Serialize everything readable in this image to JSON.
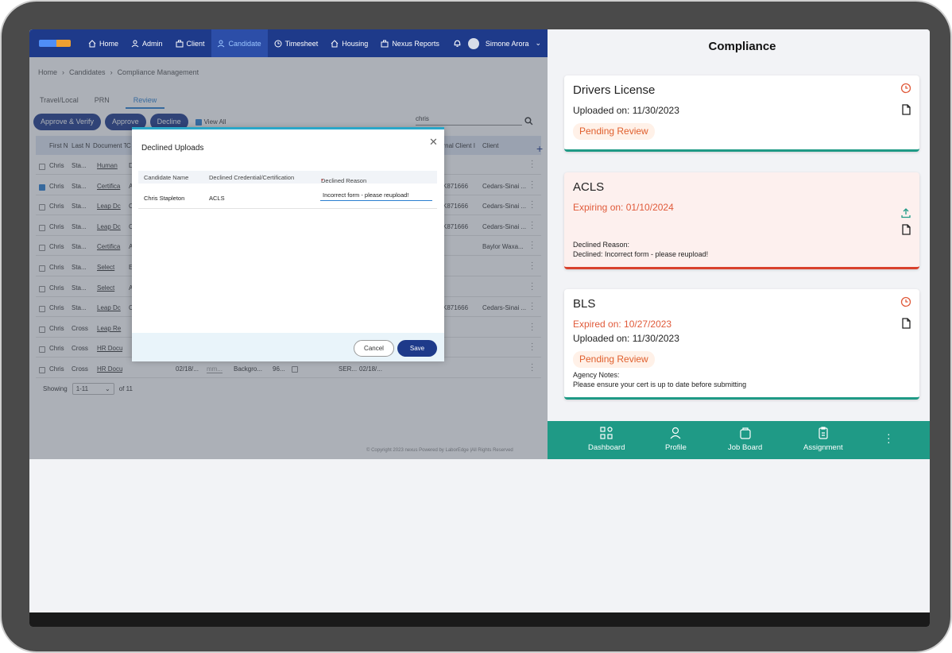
{
  "desktop": {
    "nav": {
      "items": [
        {
          "label": "Home",
          "icon": "home-icon"
        },
        {
          "label": "Admin",
          "icon": "user-icon"
        },
        {
          "label": "Client",
          "icon": "briefcase-icon"
        },
        {
          "label": "Candidate",
          "icon": "users-icon",
          "active": true
        },
        {
          "label": "Timesheet",
          "icon": "clock-icon"
        },
        {
          "label": "Housing",
          "icon": "house-icon"
        },
        {
          "label": "Nexus Reports",
          "icon": "briefcase-icon"
        }
      ],
      "user_name": "Simone Arora"
    },
    "breadcrumb": [
      "Home",
      "Candidates",
      "Compliance Management"
    ],
    "tabs": [
      "Travel/Local",
      "PRN",
      "Review"
    ],
    "actions": {
      "approve_verify": "Approve & Verify",
      "approve": "Approve",
      "decline": "Decline",
      "view_all": "View All"
    },
    "search_value": "chris",
    "table": {
      "headers": [
        "First N",
        "Last N",
        "Document T",
        "C",
        "",
        "",
        "",
        "",
        "",
        "",
        "ernal Client I",
        "Client"
      ],
      "rows": [
        {
          "first": "Chris",
          "last": "Sta...",
          "doc": "Human",
          "c": "D",
          "ext": "",
          "client": ""
        },
        {
          "first": "Chris",
          "last": "Sta...",
          "doc": "Certifica",
          "c": "A",
          "ext": "K871666",
          "client": "Cedars-Sinai ..."
        },
        {
          "first": "Chris",
          "last": "Sta...",
          "doc": "Leap Dc",
          "c": "C",
          "ext": "K871666",
          "client": "Cedars-Sinai ..."
        },
        {
          "first": "Chris",
          "last": "Sta...",
          "doc": "Leap Dc",
          "c": "C",
          "ext": "K871666",
          "client": "Cedars-Sinai ..."
        },
        {
          "first": "Chris",
          "last": "Sta...",
          "doc": "Certifica",
          "c": "A",
          "ext": "",
          "client": "Baylor Waxa..."
        },
        {
          "first": "Chris",
          "last": "Sta...",
          "doc": "Select",
          "c": "E",
          "ext": "",
          "client": ""
        },
        {
          "first": "Chris",
          "last": "Sta...",
          "doc": "Select",
          "c": "A",
          "ext": "",
          "client": ""
        },
        {
          "first": "Chris",
          "last": "Sta...",
          "doc": "Leap Dc",
          "c": "C",
          "ext": "K871666",
          "client": "Cedars-Sinai ..."
        },
        {
          "first": "Chris",
          "last": "Cross",
          "doc": "Leap Re",
          "c": "",
          "ext": "",
          "client": ""
        },
        {
          "first": "Chris",
          "last": "Cross",
          "doc": "HR Docu",
          "c": "",
          "ext": "",
          "client": ""
        },
        {
          "first": "Chris",
          "last": "Cross",
          "doc": "HR Docu",
          "c": "",
          "date": "02/18/...",
          "placeholder": "mm...",
          "type": "Backgro...",
          "num": "96...",
          "ser": "SER...",
          "date2": "02/18/..."
        }
      ]
    },
    "pager": {
      "showing": "Showing",
      "range": "1-11",
      "of": "of 11"
    },
    "copyright": "© Copyright 2023 nexus Powered by LaborEdge |All Rights Reserved"
  },
  "modal": {
    "title": "Declined Uploads",
    "headers": {
      "candidate": "Candidate Name",
      "credential": "Declined Credential/Certification",
      "reason": "Declined Reason",
      "required_mark": "*"
    },
    "row": {
      "candidate": "Chris Stapleton",
      "credential": "ACLS",
      "reason": "Incorrect form - please reupload!"
    },
    "cancel": "Cancel",
    "save": "Save"
  },
  "mobile": {
    "title": "Compliance",
    "cards": [
      {
        "title": "Drivers License",
        "uploaded": "Uploaded on: 11/30/2023",
        "status": "Pending Review"
      },
      {
        "title": "ACLS",
        "expiring": "Expiring on: 01/10/2024",
        "declined_label": "Declined Reason:",
        "declined_text": "Declined: Incorrect form - please reupload!"
      },
      {
        "title": "BLS",
        "expired": "Expired on: 10/27/2023",
        "uploaded": "Uploaded on: 11/30/2023",
        "status": "Pending Review",
        "notes_label": "Agency Notes:",
        "notes_text": "Please ensure your cert is up to date before submitting"
      }
    ],
    "bottom_nav": [
      {
        "label": "Dashboard",
        "icon": "dashboard-icon"
      },
      {
        "label": "Profile",
        "icon": "profile-icon"
      },
      {
        "label": "Job Board",
        "icon": "job-board-icon"
      },
      {
        "label": "Assignment",
        "icon": "clipboard-icon"
      }
    ]
  },
  "colors": {
    "navy": "#1e3a8a",
    "teal": "#1f9a86",
    "warning": "#e05a3a",
    "pending_bg": "#fff1e8"
  }
}
